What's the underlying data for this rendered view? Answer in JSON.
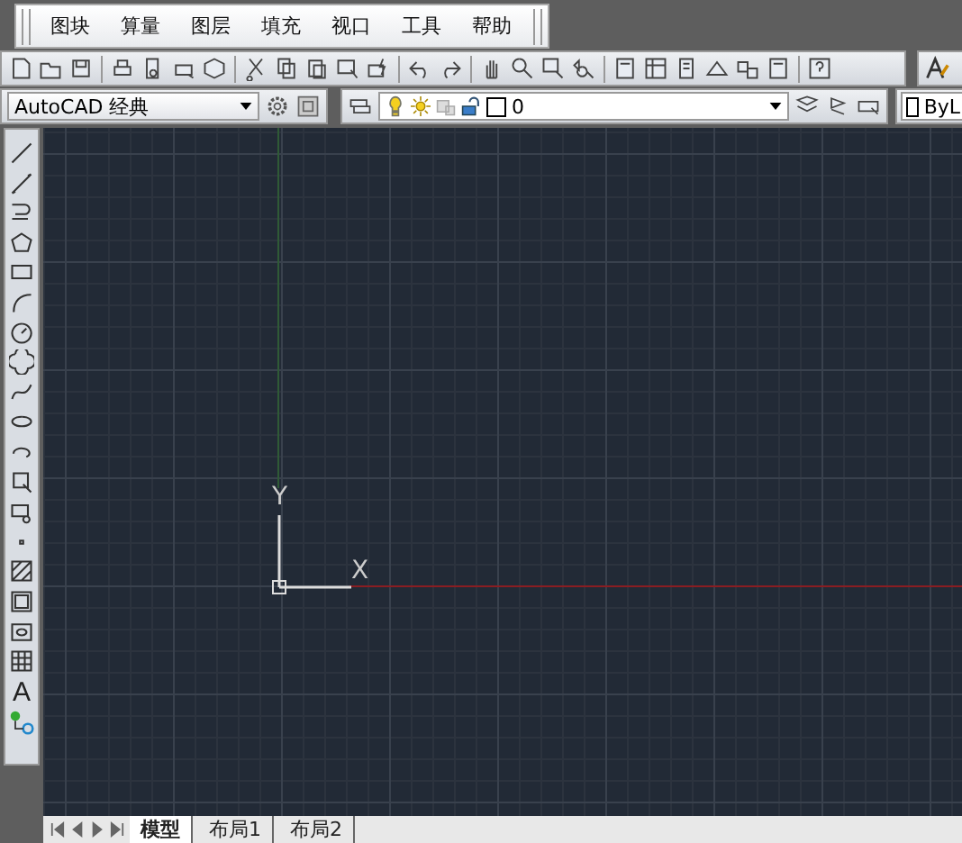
{
  "menu_bar": {
    "items": [
      "图块",
      "算量",
      "图层",
      "填充",
      "视口",
      "工具",
      "帮助"
    ]
  },
  "workspace_dropdown": {
    "value": "AutoCAD 经典"
  },
  "layer_dropdown": {
    "value": "0",
    "light_on": true,
    "locked": false
  },
  "color_dropdown": {
    "value": "ByL"
  },
  "left_toolbar": {
    "text_tool": "A"
  },
  "canvas": {
    "y_label": "Y",
    "x_label": "X"
  },
  "layout_tabs": [
    {
      "label": "模型",
      "selected": true
    },
    {
      "label": "布局1",
      "selected": false
    },
    {
      "label": "布局2",
      "selected": false
    }
  ]
}
